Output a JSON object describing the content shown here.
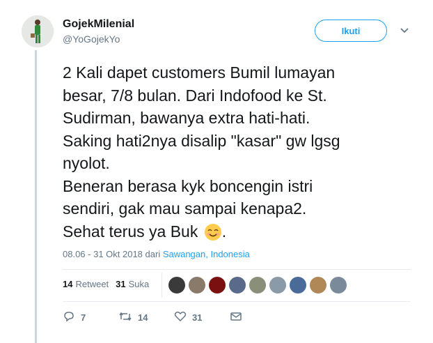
{
  "user": {
    "name": "GojekMilenial",
    "handle": "@YoGojekYo"
  },
  "follow_label": "Ikuti",
  "tweet": {
    "lines": [
      "2 Kali dapet customers Bumil lumayan",
      "besar, 7/8 bulan. Dari Indofood ke St.",
      "Sudirman, bawanya extra hati-hati.",
      "Saking hati2nya disalip \"kasar\" gw lgsg",
      "nyolot.",
      "Beneran berasa kyk boncengin istri",
      "sendiri, gak mau sampai kenapa2.",
      "Sehat terus ya Buk"
    ],
    "emoji_name": "smiling-face-with-smiling-eyes",
    "end_text": "."
  },
  "meta": {
    "timestamp": "08.06 - 31 Okt 2018 dari ",
    "location": "Sawangan, Indonesia"
  },
  "stats": {
    "retweets": "14",
    "retweets_label": "Retweet",
    "likes": "31",
    "likes_label": "Suka"
  },
  "likers": [
    {
      "color": "#3a3a3a"
    },
    {
      "color": "#8a7a6a"
    },
    {
      "color": "#7a1010"
    },
    {
      "color": "#5a6a8a"
    },
    {
      "color": "#8a8f7a"
    },
    {
      "color": "#8a9aa8"
    },
    {
      "color": "#4a6a9a"
    },
    {
      "color": "#b08858"
    },
    {
      "color": "#7a8a9a"
    }
  ],
  "actions": {
    "reply_count": "7",
    "retweet_count": "14",
    "like_count": "31"
  },
  "colors": {
    "accent": "#1da1f2",
    "muted": "#657786",
    "text": "#14171a",
    "border": "#e6ecf0"
  }
}
